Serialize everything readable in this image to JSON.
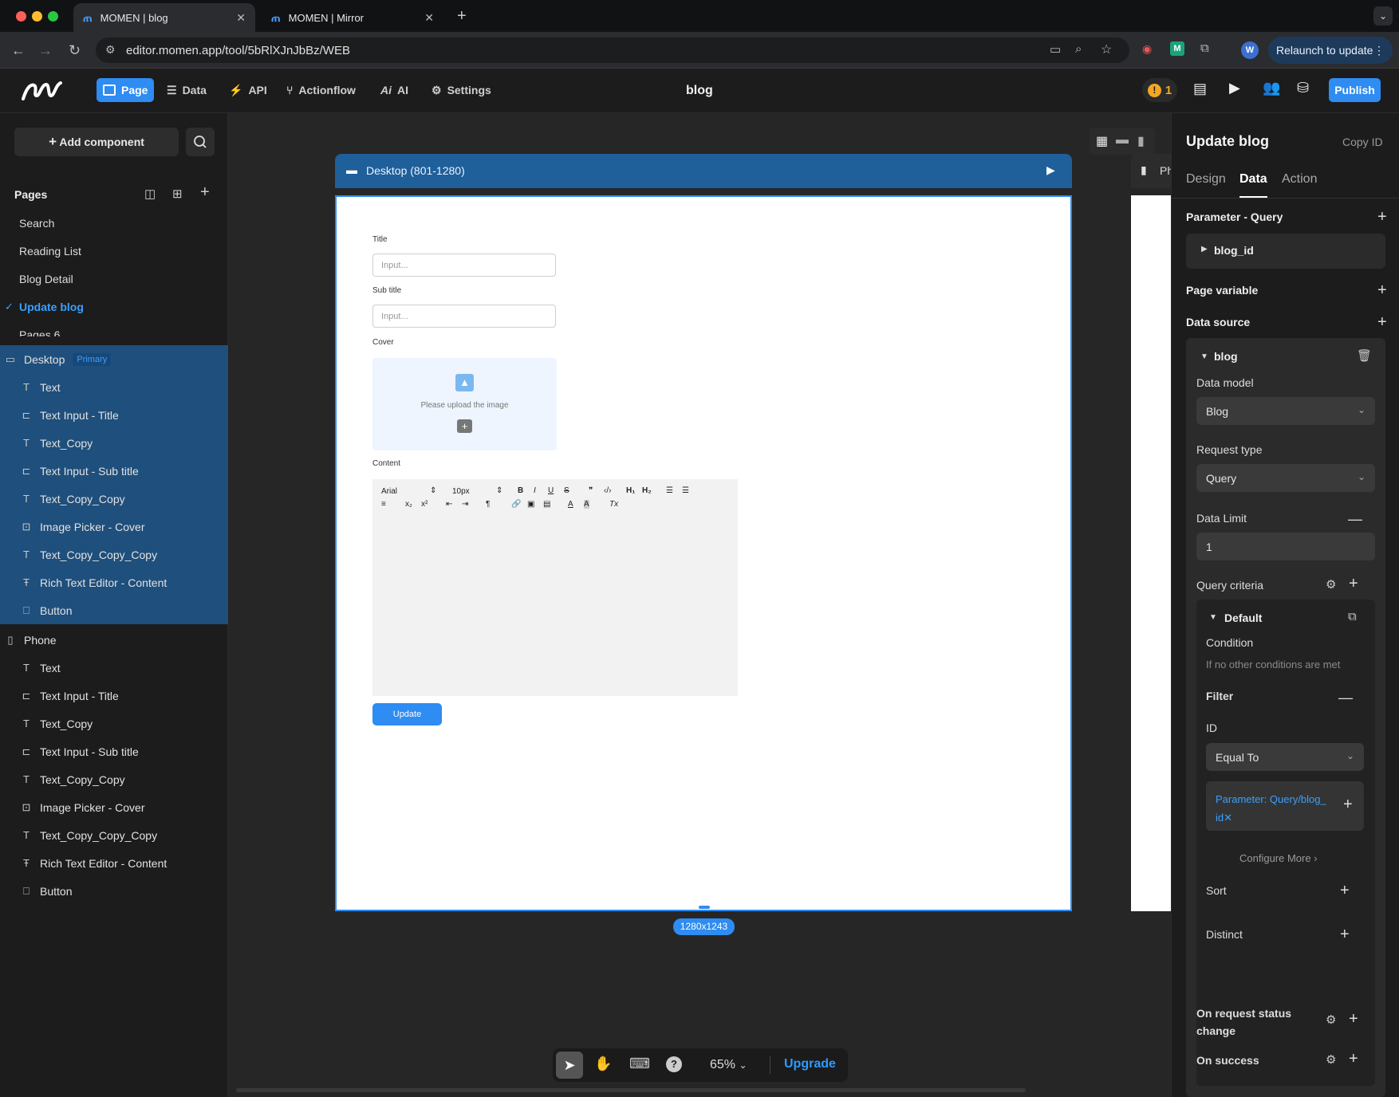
{
  "browser": {
    "tabs": [
      {
        "title": "MOMEN | blog",
        "active": true
      },
      {
        "title": "MOMEN | Mirror",
        "active": false
      }
    ],
    "url": "editor.momen.app/tool/5bRlXJnJbBz/WEB",
    "relaunch_label": "Relaunch to update",
    "profile_initial": "W"
  },
  "topbar": {
    "nav": [
      {
        "label": "Page",
        "icon": "page-icon"
      },
      {
        "label": "Data",
        "icon": "database-icon"
      },
      {
        "label": "API",
        "icon": "api-icon"
      },
      {
        "label": "Actionflow",
        "icon": "actionflow-icon"
      },
      {
        "label": "AI",
        "icon": "ai-icon"
      },
      {
        "label": "Settings",
        "icon": "gear-icon"
      }
    ],
    "title": "blog",
    "warning_count": "1",
    "publish_label": "Publish"
  },
  "sidebar": {
    "add_component_label": "Add component",
    "pages_header": "Pages",
    "pages": [
      {
        "label": "Search"
      },
      {
        "label": "Reading List"
      },
      {
        "label": "Blog Detail"
      },
      {
        "label": "Update blog",
        "selected": true
      },
      {
        "label": "Pages 6"
      }
    ],
    "desktop": {
      "label": "Desktop",
      "badge": "Primary",
      "items": [
        {
          "label": "Text",
          "icon": "text-icon"
        },
        {
          "label": "Text Input - Title",
          "icon": "text-input-icon"
        },
        {
          "label": "Text_Copy",
          "icon": "text-icon"
        },
        {
          "label": "Text Input - Sub title",
          "icon": "text-input-icon"
        },
        {
          "label": "Text_Copy_Copy",
          "icon": "text-icon"
        },
        {
          "label": "Image Picker - Cover",
          "icon": "image-picker-icon"
        },
        {
          "label": "Text_Copy_Copy_Copy",
          "icon": "text-icon"
        },
        {
          "label": "Rich Text Editor - Content",
          "icon": "rich-text-icon"
        },
        {
          "label": "Button",
          "icon": "button-icon"
        }
      ]
    },
    "phone": {
      "label": "Phone",
      "items": [
        {
          "label": "Text",
          "icon": "text-icon"
        },
        {
          "label": "Text Input - Title",
          "icon": "text-input-icon"
        },
        {
          "label": "Text_Copy",
          "icon": "text-icon"
        },
        {
          "label": "Text Input - Sub title",
          "icon": "text-input-icon"
        },
        {
          "label": "Text_Copy_Copy",
          "icon": "text-icon"
        },
        {
          "label": "Image Picker - Cover",
          "icon": "image-picker-icon"
        },
        {
          "label": "Text_Copy_Copy_Copy",
          "icon": "text-icon"
        },
        {
          "label": "Rich Text Editor - Content",
          "icon": "rich-text-icon"
        },
        {
          "label": "Button",
          "icon": "button-icon"
        }
      ]
    }
  },
  "canvas": {
    "frame_label": "Desktop (801-1280)",
    "phone_label": "Ph",
    "form": {
      "title_label": "Title",
      "title_placeholder": "Input...",
      "subtitle_label": "Sub title",
      "subtitle_placeholder": "Input...",
      "cover_label": "Cover",
      "cover_hint": "Please upload the image",
      "content_label": "Content",
      "rte_font": "Arial",
      "rte_size": "10px",
      "update_label": "Update"
    },
    "size_label": "1280x1243",
    "zoom": "65%",
    "upgrade_label": "Upgrade"
  },
  "panel": {
    "title": "Update blog",
    "copy_id": "Copy ID",
    "tabs": [
      {
        "label": "Design"
      },
      {
        "label": "Data",
        "active": true
      },
      {
        "label": "Action"
      }
    ],
    "param_query_header": "Parameter - Query",
    "param_blog_id": "blog_id",
    "page_variable_header": "Page variable",
    "data_source_header": "Data source",
    "ds_name": "blog",
    "data_model_label": "Data model",
    "data_model_value": "Blog",
    "request_type_label": "Request type",
    "request_type_value": "Query",
    "data_limit_label": "Data Limit",
    "data_limit_value": "1",
    "query_criteria_label": "Query criteria",
    "default_label": "Default",
    "condition_label": "Condition",
    "condition_value": "If no other conditions are met",
    "filter_label": "Filter",
    "id_label": "ID",
    "operator_value": "Equal To",
    "param_chip_line1": "Parameter: Query/blog_",
    "param_chip_line2": "id",
    "configure_more": "Configure More",
    "sort_label": "Sort",
    "distinct_label": "Distinct",
    "on_request_status_line1": "On request status",
    "on_request_status_line2": "change",
    "on_success_label": "On success"
  },
  "colors": {
    "accent": "#2e8cf2",
    "selected_bg": "#1f4f7c",
    "frame_header": "#1f5f9a",
    "warning": "#f4a623"
  }
}
